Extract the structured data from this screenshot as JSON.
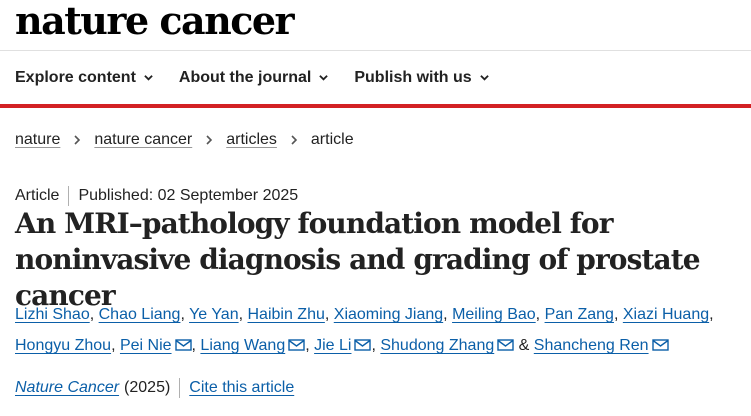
{
  "masthead": {
    "logo": "nature cancer"
  },
  "nav": {
    "items": [
      {
        "label": "Explore content"
      },
      {
        "label": "About the journal"
      },
      {
        "label": "Publish with us"
      }
    ],
    "accent_color": "#d32124"
  },
  "breadcrumb": {
    "items": [
      "nature",
      "nature cancer",
      "articles"
    ],
    "current": "article"
  },
  "article": {
    "type": "Article",
    "published": "Published: 02 September 2025",
    "title": "An MRI–pathology foundation model for noninvasive diagnosis and grading of prostate cancer",
    "authors": [
      {
        "name": "Lizhi Shao",
        "email": false
      },
      {
        "name": "Chao Liang",
        "email": false
      },
      {
        "name": "Ye Yan",
        "email": false
      },
      {
        "name": "Haibin Zhu",
        "email": false
      },
      {
        "name": "Xiaoming Jiang",
        "email": false
      },
      {
        "name": "Meiling Bao",
        "email": false
      },
      {
        "name": "Pan Zang",
        "email": false
      },
      {
        "name": "Xiazi Huang",
        "email": false
      },
      {
        "name": "Hongyu Zhou",
        "email": false
      },
      {
        "name": "Pei Nie",
        "email": true
      },
      {
        "name": "Liang Wang",
        "email": true
      },
      {
        "name": "Jie Li",
        "email": true
      },
      {
        "name": "Shudong Zhang",
        "email": true
      },
      {
        "name": "Shancheng Ren",
        "email": true
      }
    ],
    "link_color": "#0b5fa8",
    "journal": "Nature Cancer",
    "year": "(2025)",
    "cite_label": "Cite this article"
  }
}
